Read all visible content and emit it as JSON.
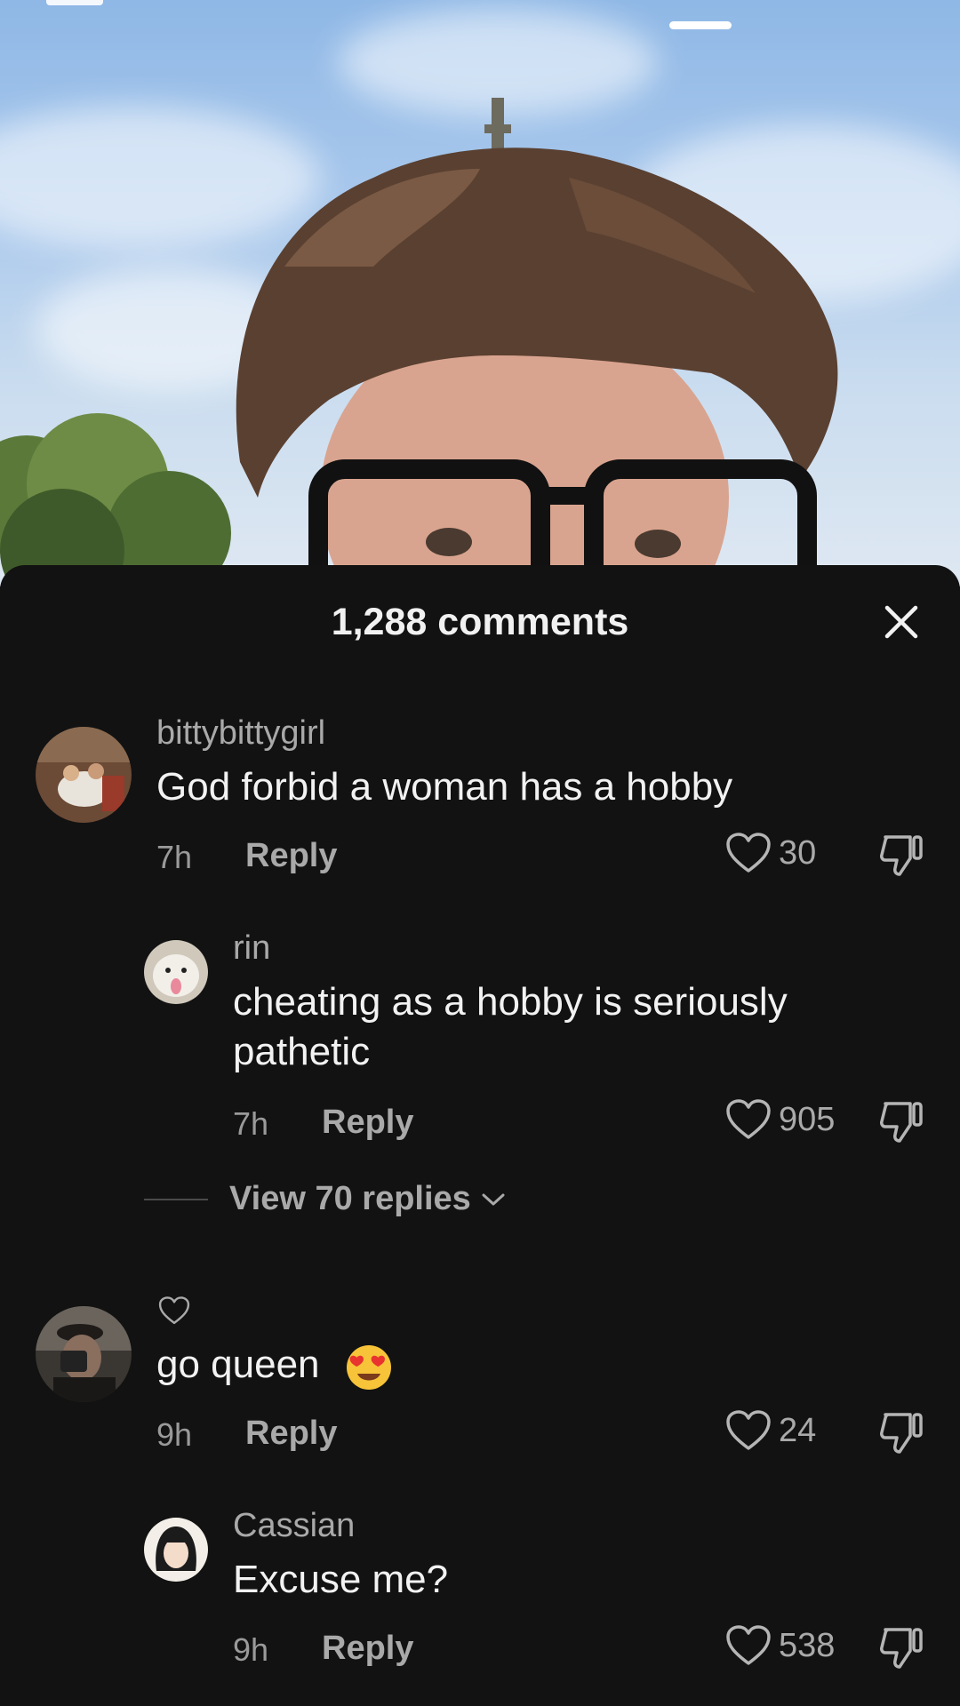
{
  "sheet": {
    "title": "1,288 comments"
  },
  "comments": [
    {
      "username": "bittybittygirl",
      "text": "God forbid a woman has a hobby",
      "time": "7h",
      "reply": "Reply",
      "likes": "30"
    },
    {
      "username": "rin",
      "text": "cheating as a hobby is seriously pathetic",
      "time": "7h",
      "reply": "Reply",
      "likes": "905"
    },
    {
      "username": "",
      "text": "go queen",
      "emoji": "smiling-face-with-heart-eyes",
      "time": "9h",
      "reply": "Reply",
      "likes": "24"
    },
    {
      "username": "Cassian",
      "text": "Excuse me?",
      "time": "9h",
      "reply": "Reply",
      "likes": "538"
    }
  ],
  "view_replies": {
    "label": "View 70 replies"
  },
  "icons": {
    "close": "close-icon",
    "like": "heart-outline-icon",
    "dislike": "thumbs-down-icon",
    "chevron": "chevron-down-icon",
    "creator_liked": "small-heart-icon"
  },
  "colors": {
    "background": "#121212",
    "text": "#f2f2f2",
    "muted": "#a9a9a9"
  }
}
